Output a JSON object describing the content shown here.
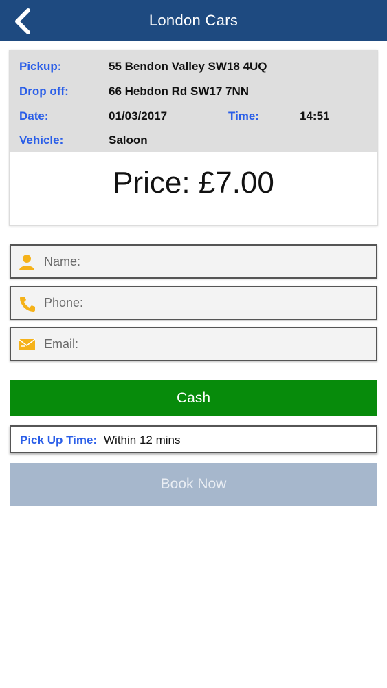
{
  "header": {
    "title": "London Cars",
    "back_icon": "chevron-left-icon",
    "background": "#1e4a80"
  },
  "booking": {
    "pickup_label": "Pickup:",
    "pickup_value": "55 Bendon Valley SW18 4UQ",
    "dropoff_label": "Drop off:",
    "dropoff_value": "66 Hebdon Rd SW17 7NN",
    "date_label": "Date:",
    "date_value": "01/03/2017",
    "time_label": "Time:",
    "time_value": "14:51",
    "vehicle_label": "Vehicle:",
    "vehicle_value": "Saloon",
    "price": "Price: £7.00"
  },
  "form": {
    "name_placeholder": "Name:",
    "phone_placeholder": "Phone:",
    "email_placeholder": "Email:",
    "icons": [
      "user-icon",
      "phone-icon",
      "email-icon"
    ],
    "icon_color": "#f5b21a"
  },
  "payment": {
    "cash_label": "Cash",
    "cash_color": "#078b0b"
  },
  "pickup_time": {
    "label": "Pick Up Time:",
    "value": "Within 12 mins"
  },
  "book": {
    "label": "Book Now",
    "color": "#a6b7cc"
  },
  "colors": {
    "label_blue": "#2a5ee8"
  }
}
